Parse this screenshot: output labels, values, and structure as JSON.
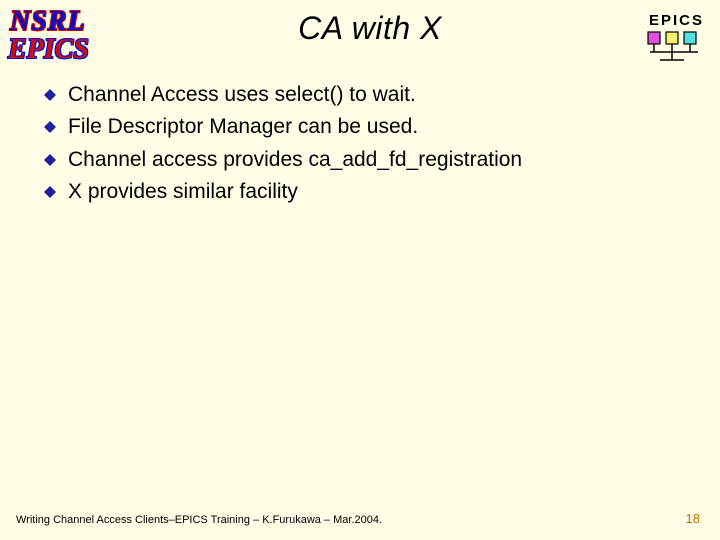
{
  "header": {
    "title": "CA with X",
    "epics_label": "EPICS",
    "side_label_1": "NSRL",
    "side_label_2": "EPICS"
  },
  "bullets": [
    "Channel Access uses select() to wait.",
    "File Descriptor Manager can be used.",
    "Channel access provides ca_add_fd_registration",
    "X provides similar facility"
  ],
  "footer": {
    "text": "Writing Channel Access Clients–EPICS Training – K.Furukawa – Mar.2004.",
    "page": "18"
  },
  "colors": {
    "background": "#fffde6",
    "bullet_diamond": "#2020a0",
    "pagenum": "#c07000"
  }
}
